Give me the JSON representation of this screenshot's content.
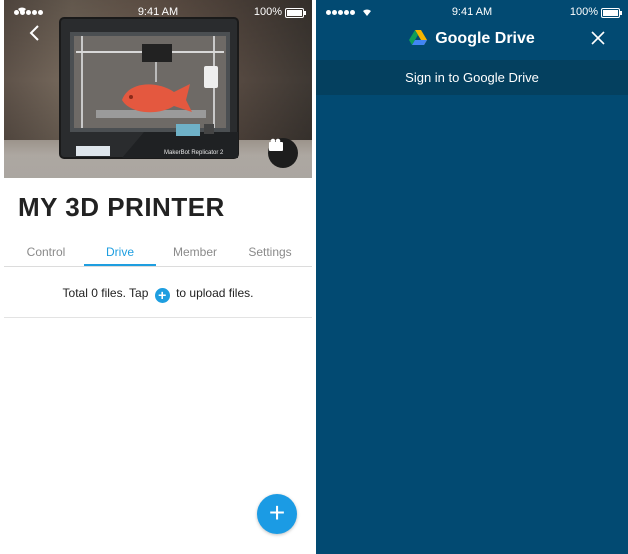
{
  "left_screen": {
    "status_bar": {
      "signal": "•••••",
      "time": "9:41 AM",
      "battery": "100%"
    },
    "printer_brand": "MakerBot Replicator 2",
    "title": "MY 3D PRINTER",
    "tabs": [
      {
        "label": "Control",
        "active": false
      },
      {
        "label": "Drive",
        "active": true
      },
      {
        "label": "Member",
        "active": false
      },
      {
        "label": "Settings",
        "active": false
      }
    ],
    "info": {
      "before": "Total 0 files. Tap",
      "after": "to upload files."
    },
    "icons": {
      "back": "chevron-left-icon",
      "camera": "camera-icon",
      "upload": "plus-icon",
      "fab": "plus-icon"
    },
    "colors": {
      "accent": "#1e9ee0",
      "title": "#222222"
    }
  },
  "right_screen": {
    "status_bar": {
      "signal": "•••••",
      "time": "9:41 AM",
      "battery": "100%"
    },
    "header": {
      "title": "Google Drive"
    },
    "sign_in_label": "Sign in to Google Drive",
    "icons": {
      "logo": "google-drive-logo-icon",
      "close": "close-icon"
    },
    "colors": {
      "background": "#024a72",
      "sign_in_bar": "#04405f"
    }
  }
}
